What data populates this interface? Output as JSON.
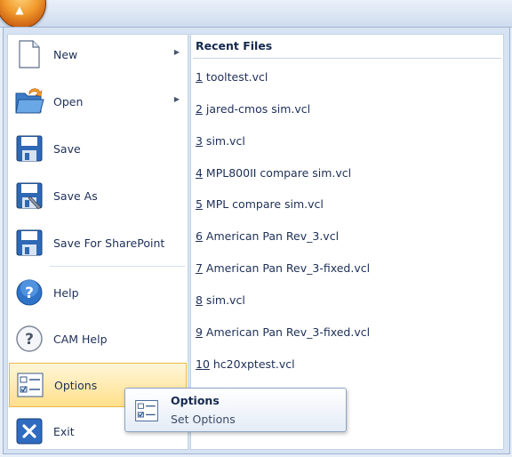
{
  "app": {
    "orb_icon": "office-orb-icon"
  },
  "menu": {
    "items": [
      {
        "label": "New",
        "icon": "new-document-icon",
        "has_submenu": true
      },
      {
        "label": "Open",
        "icon": "open-folder-icon",
        "has_submenu": true
      },
      {
        "label": "Save",
        "icon": "save-icon",
        "has_submenu": false
      },
      {
        "label": "Save As",
        "icon": "save-as-icon",
        "has_submenu": false
      },
      {
        "label": "Save For SharePoint",
        "icon": "save-sharepoint-icon",
        "has_submenu": false
      },
      {
        "label": "Help",
        "icon": "help-icon",
        "has_submenu": false
      },
      {
        "label": "CAM Help",
        "icon": "cam-help-icon",
        "has_submenu": false
      },
      {
        "label": "Options",
        "icon": "options-icon",
        "has_submenu": false,
        "highlighted": true
      },
      {
        "label": "Exit",
        "icon": "exit-icon",
        "has_submenu": false
      }
    ]
  },
  "recent_files": {
    "title": "Recent Files",
    "items": [
      {
        "accel": "1",
        "name": " tooltest.vcl"
      },
      {
        "accel": "2",
        "name": " jared-cmos sim.vcl"
      },
      {
        "accel": "3",
        "name": " sim.vcl"
      },
      {
        "accel": "4",
        "name": " MPL800II compare sim.vcl"
      },
      {
        "accel": "5",
        "name": " MPL compare sim.vcl"
      },
      {
        "accel": "6",
        "name": " American Pan Rev_3.vcl"
      },
      {
        "accel": "7",
        "name": " American Pan Rev_3-fixed.vcl"
      },
      {
        "accel": "8",
        "name": " sim.vcl"
      },
      {
        "accel": "9",
        "name": " American Pan Rev_3-fixed.vcl"
      },
      {
        "accel": "10",
        "name": " hc20xptest.vcl"
      }
    ]
  },
  "tooltip": {
    "title": "Options",
    "description": "Set Options"
  },
  "colors": {
    "highlight": "#ffe08a",
    "text": "#1d2f57"
  }
}
